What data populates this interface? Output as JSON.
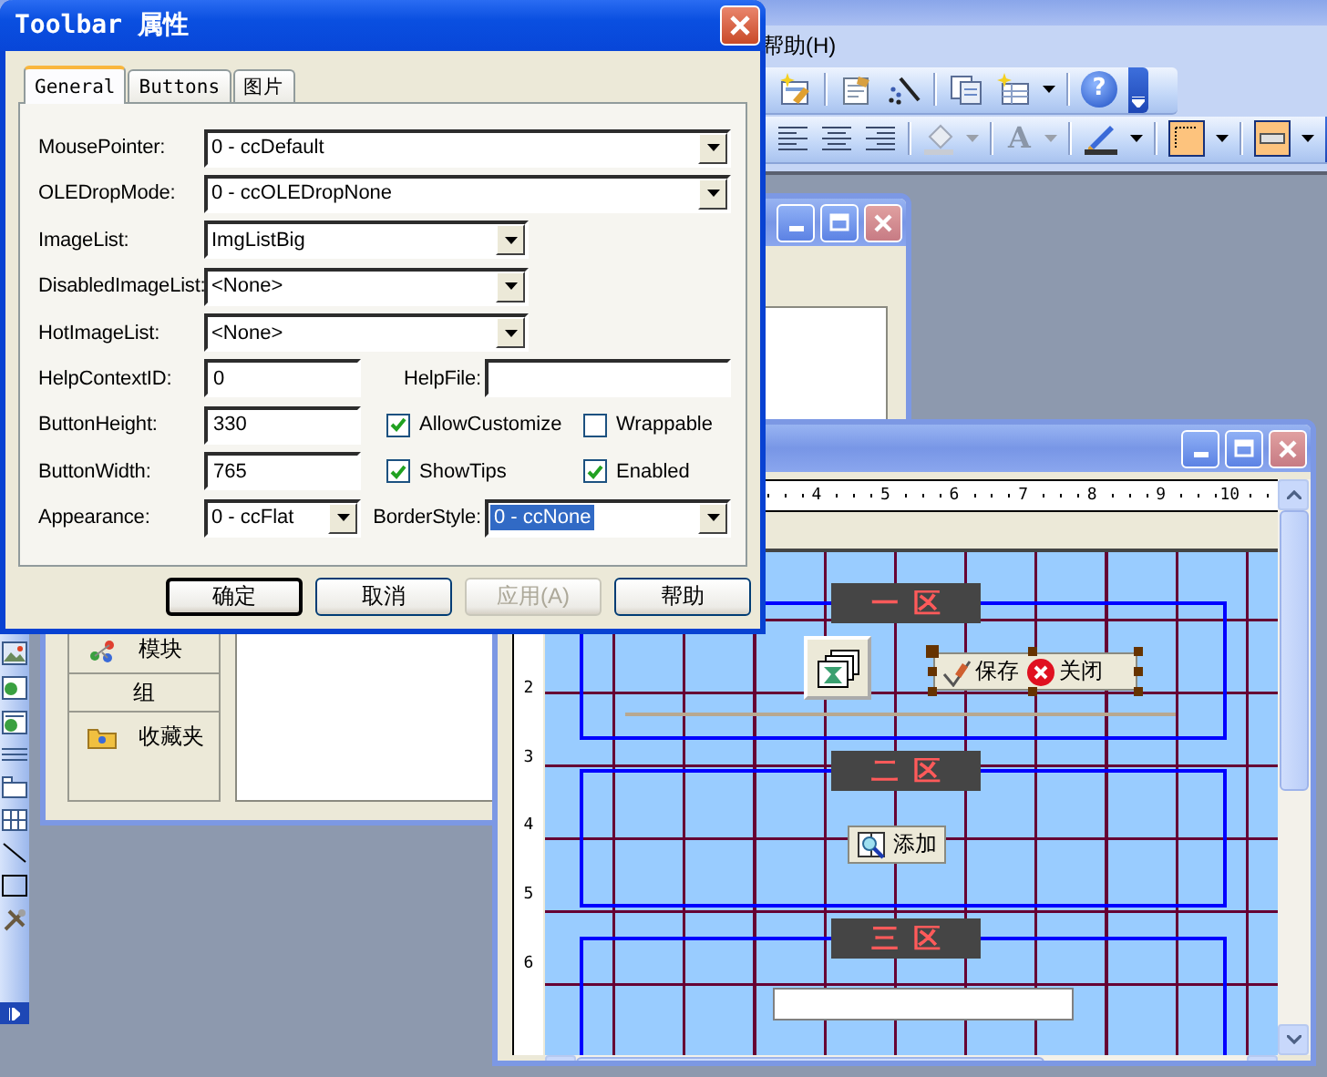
{
  "app": {
    "menu_items": [
      "帮助(H)"
    ],
    "help_glyph": "?",
    "font_color_glyph": "A"
  },
  "database_window": {
    "items": [
      {
        "kind": "item",
        "label": "模块"
      },
      {
        "kind": "header",
        "label": "组"
      },
      {
        "kind": "item",
        "label": "收藏夹"
      }
    ]
  },
  "form_window": {
    "ruler_h": [
      "4",
      "5",
      "6",
      "7",
      "8",
      "9",
      "10"
    ],
    "ruler_v": [
      "2",
      "3",
      "4",
      "5",
      "6"
    ],
    "sections": [
      {
        "title": "一区",
        "controls": [
          {
            "kind": "imagelist"
          },
          {
            "kind": "toolbar",
            "selected": true,
            "buttons": [
              {
                "label": "保存"
              },
              {
                "label": "关闭"
              }
            ]
          },
          {
            "kind": "line"
          }
        ]
      },
      {
        "title": "二区",
        "controls": [
          {
            "kind": "button",
            "label": "添加"
          }
        ]
      },
      {
        "title": "三区",
        "controls": [
          {
            "kind": "textbox"
          }
        ]
      }
    ]
  },
  "dialog": {
    "title": "Toolbar 属性",
    "tabs": [
      {
        "label": "General",
        "selected": true
      },
      {
        "label": "Buttons",
        "selected": false
      },
      {
        "label": "图片",
        "selected": false
      }
    ],
    "rows": [
      {
        "cells": [
          {
            "kind": "widecombo",
            "label": "MousePointer:",
            "value": "0 - ccDefault",
            "focused": false
          }
        ]
      },
      {
        "cells": [
          {
            "kind": "widecombo",
            "label": "OLEDropMode:",
            "value": "0 - ccOLEDropNone",
            "focused": false
          }
        ]
      },
      {
        "cells": [
          {
            "kind": "combo",
            "label": "ImageList:",
            "value": "ImgListBig",
            "focused": false
          }
        ]
      },
      {
        "cells": [
          {
            "kind": "combo",
            "label": "DisabledImageList:",
            "value": "<None>",
            "focused": false
          }
        ]
      },
      {
        "cells": [
          {
            "kind": "combo",
            "label": "HotImageList:",
            "value": "<None>",
            "focused": false
          }
        ]
      },
      {
        "cells": [
          {
            "kind": "text",
            "label": "HelpContextID:",
            "value": "0"
          },
          {
            "kind": "text",
            "label": "HelpFile:"
          }
        ]
      },
      {
        "cells": [
          {
            "kind": "text",
            "label": "ButtonHeight:",
            "value": "330"
          },
          {
            "kind": "checkbox",
            "label": "AllowCustomize",
            "checked": true
          },
          {
            "kind": "checkbox",
            "label": "Wrappable",
            "checked": false
          }
        ]
      },
      {
        "cells": [
          {
            "kind": "text",
            "label": "ButtonWidth:",
            "value": "765"
          },
          {
            "kind": "checkbox",
            "label": "ShowTips",
            "checked": true
          },
          {
            "kind": "checkbox",
            "label": "Enabled",
            "checked": true
          }
        ]
      },
      {
        "cells": [
          {
            "kind": "combo",
            "label": "Appearance:",
            "value": "0 - ccFlat",
            "focused": false
          },
          {
            "kind": "combo",
            "label": "BorderStyle:",
            "value": "0 - ccNone",
            "focused": true
          }
        ]
      }
    ],
    "buttons": [
      {
        "label": "确定",
        "default": true,
        "disabled": false
      },
      {
        "label": "取消",
        "default": false,
        "disabled": false
      },
      {
        "label": "应用(A)",
        "default": false,
        "disabled": true
      },
      {
        "label": "帮助",
        "default": false,
        "disabled": false
      }
    ]
  }
}
